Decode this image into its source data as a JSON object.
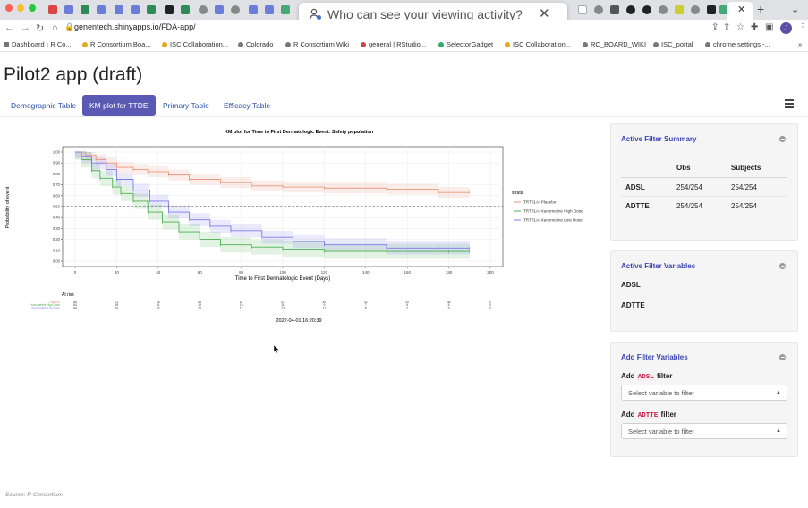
{
  "browser": {
    "url": "genentech.shinyapps.io/FDA-app/",
    "popup_text": "Who can see your viewing activity?",
    "avatar_letter": "J",
    "bookmarks": [
      "Dashboard ‹ R Co...",
      "R Consortium Boa...",
      "ISC Collaboration...",
      "Colorado",
      "R Consortium Wiki",
      "general | RStudio...",
      "SelectorGadget",
      "ISC Collaboration...",
      "RC_BOARD_WIKI",
      "ISC_portal",
      "chrome settings -..."
    ]
  },
  "app": {
    "title": "Pilot2 app (draft)",
    "tabs": [
      "Demographic Table",
      "KM plot for TTDE",
      "Primary Table",
      "Efficacy Table"
    ],
    "active_tab": "KM plot for TTDE"
  },
  "plot": {
    "title": "KM plot for Time to First Dermatologic Event: Safety population",
    "timestamp": "2022-04-01 16:20:39",
    "at_risk_label": "At risk",
    "strata_label": "strata"
  },
  "chart_data": {
    "type": "line",
    "title": "KM plot for Time to First Dermatologic Event: Safety population",
    "xlabel": "Time to First Dermatologic Event (Days)",
    "ylabel": "Probability of event",
    "xlim": [
      0,
      200
    ],
    "ylim": [
      0,
      1
    ],
    "x_ticks": [
      0,
      20,
      40,
      60,
      80,
      100,
      120,
      140,
      160,
      180,
      200
    ],
    "y_ticks": [
      0.0,
      0.1,
      0.2,
      0.3,
      0.4,
      0.5,
      0.6,
      0.7,
      0.8,
      0.9,
      1.0
    ],
    "y_tick_labels": [
      "0.00",
      "0.10",
      "0.20",
      "0.30",
      "0.40",
      "0.50",
      "0.60",
      "0.70",
      "0.80",
      "0.90",
      "1.00"
    ],
    "reference_line_y": 0.5,
    "grid": true,
    "legend": "right",
    "series": [
      {
        "name": "TRT01A=Placebo",
        "color": "#e9967a",
        "x": [
          0,
          5,
          10,
          15,
          20,
          28,
          35,
          45,
          55,
          70,
          85,
          100,
          120,
          150,
          175,
          190
        ],
        "y": [
          1.0,
          0.97,
          0.93,
          0.9,
          0.86,
          0.84,
          0.82,
          0.79,
          0.75,
          0.72,
          0.69,
          0.68,
          0.67,
          0.66,
          0.63,
          0.63
        ],
        "band": 0.05
      },
      {
        "name": "TRT01A=Xanomeline High Dose",
        "color": "#4caf50",
        "x": [
          0,
          3,
          8,
          12,
          18,
          22,
          28,
          35,
          42,
          50,
          60,
          70,
          85,
          100,
          120,
          150,
          180,
          190
        ],
        "y": [
          1.0,
          0.93,
          0.83,
          0.76,
          0.68,
          0.62,
          0.55,
          0.45,
          0.36,
          0.27,
          0.2,
          0.15,
          0.13,
          0.11,
          0.09,
          0.09,
          0.09,
          0.09
        ],
        "band": 0.07
      },
      {
        "name": "TRT01A=Xanomeline Low Dose",
        "color": "#7b7bea",
        "x": [
          0,
          3,
          8,
          15,
          20,
          28,
          36,
          45,
          55,
          65,
          75,
          90,
          105,
          120,
          150,
          175,
          190
        ],
        "y": [
          1.0,
          0.96,
          0.9,
          0.84,
          0.75,
          0.65,
          0.55,
          0.45,
          0.38,
          0.32,
          0.28,
          0.22,
          0.18,
          0.15,
          0.12,
          0.12,
          0.12
        ],
        "band": 0.06
      }
    ],
    "risk_table": {
      "times": [
        0,
        20,
        40,
        60,
        80,
        100,
        120,
        140,
        160,
        180,
        200
      ],
      "rows": [
        {
          "label": "Placebo",
          "values": [
            "86",
            "73",
            "65",
            "58",
            "51",
            "47",
            "45",
            "42",
            "40",
            "38",
            "0"
          ]
        },
        {
          "label": "Xanomeline High Dose",
          "values": [
            "84",
            "55",
            "31",
            "16",
            "13",
            "11",
            "9",
            "7",
            "6",
            "5",
            "0"
          ]
        },
        {
          "label": "Xanomeline Low Dose",
          "values": [
            "84",
            "60",
            "37",
            "25",
            "17",
            "13",
            "11",
            "8",
            "7",
            "6",
            "0"
          ]
        }
      ]
    }
  },
  "sidebar": {
    "summary": {
      "title": "Active Filter Summary",
      "headers": [
        "",
        "Obs",
        "Subjects"
      ],
      "rows": [
        {
          "name": "ADSL",
          "obs": "254/254",
          "subjects": "254/254"
        },
        {
          "name": "ADTTE",
          "obs": "254/254",
          "subjects": "254/254"
        }
      ]
    },
    "variables": {
      "title": "Active Filter Variables",
      "items": [
        "ADSL",
        "ADTTE"
      ]
    },
    "add": {
      "title": "Add Filter Variables",
      "word_add": "Add",
      "word_filter": "filter",
      "datasets": [
        "ADSL",
        "ADTTE"
      ],
      "placeholder": "Select variable to filter"
    }
  },
  "footer": {
    "source": "Source: R Consortium"
  }
}
